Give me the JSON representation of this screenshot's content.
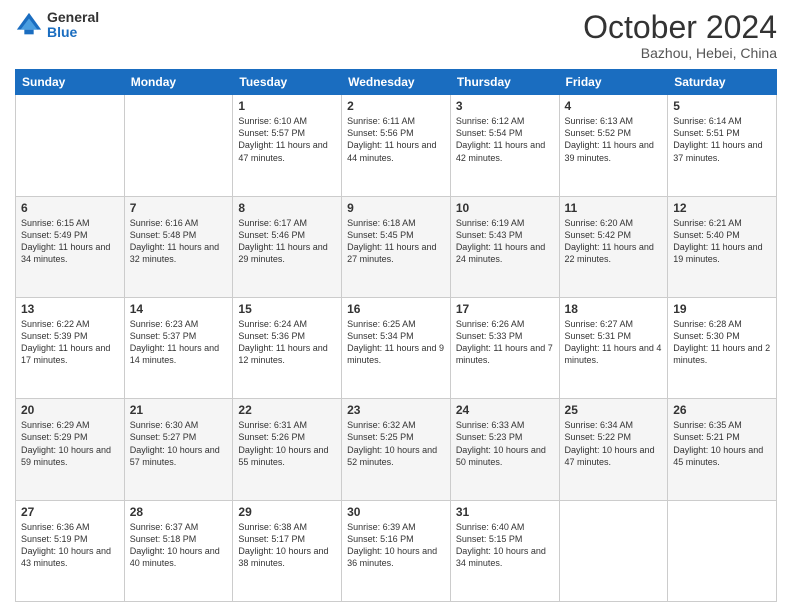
{
  "header": {
    "logo_general": "General",
    "logo_blue": "Blue",
    "month_title": "October 2024",
    "location": "Bazhou, Hebei, China"
  },
  "days_of_week": [
    "Sunday",
    "Monday",
    "Tuesday",
    "Wednesday",
    "Thursday",
    "Friday",
    "Saturday"
  ],
  "weeks": [
    [
      {
        "day": "",
        "sunrise": "",
        "sunset": "",
        "daylight": ""
      },
      {
        "day": "",
        "sunrise": "",
        "sunset": "",
        "daylight": ""
      },
      {
        "day": "1",
        "sunrise": "Sunrise: 6:10 AM",
        "sunset": "Sunset: 5:57 PM",
        "daylight": "Daylight: 11 hours and 47 minutes."
      },
      {
        "day": "2",
        "sunrise": "Sunrise: 6:11 AM",
        "sunset": "Sunset: 5:56 PM",
        "daylight": "Daylight: 11 hours and 44 minutes."
      },
      {
        "day": "3",
        "sunrise": "Sunrise: 6:12 AM",
        "sunset": "Sunset: 5:54 PM",
        "daylight": "Daylight: 11 hours and 42 minutes."
      },
      {
        "day": "4",
        "sunrise": "Sunrise: 6:13 AM",
        "sunset": "Sunset: 5:52 PM",
        "daylight": "Daylight: 11 hours and 39 minutes."
      },
      {
        "day": "5",
        "sunrise": "Sunrise: 6:14 AM",
        "sunset": "Sunset: 5:51 PM",
        "daylight": "Daylight: 11 hours and 37 minutes."
      }
    ],
    [
      {
        "day": "6",
        "sunrise": "Sunrise: 6:15 AM",
        "sunset": "Sunset: 5:49 PM",
        "daylight": "Daylight: 11 hours and 34 minutes."
      },
      {
        "day": "7",
        "sunrise": "Sunrise: 6:16 AM",
        "sunset": "Sunset: 5:48 PM",
        "daylight": "Daylight: 11 hours and 32 minutes."
      },
      {
        "day": "8",
        "sunrise": "Sunrise: 6:17 AM",
        "sunset": "Sunset: 5:46 PM",
        "daylight": "Daylight: 11 hours and 29 minutes."
      },
      {
        "day": "9",
        "sunrise": "Sunrise: 6:18 AM",
        "sunset": "Sunset: 5:45 PM",
        "daylight": "Daylight: 11 hours and 27 minutes."
      },
      {
        "day": "10",
        "sunrise": "Sunrise: 6:19 AM",
        "sunset": "Sunset: 5:43 PM",
        "daylight": "Daylight: 11 hours and 24 minutes."
      },
      {
        "day": "11",
        "sunrise": "Sunrise: 6:20 AM",
        "sunset": "Sunset: 5:42 PM",
        "daylight": "Daylight: 11 hours and 22 minutes."
      },
      {
        "day": "12",
        "sunrise": "Sunrise: 6:21 AM",
        "sunset": "Sunset: 5:40 PM",
        "daylight": "Daylight: 11 hours and 19 minutes."
      }
    ],
    [
      {
        "day": "13",
        "sunrise": "Sunrise: 6:22 AM",
        "sunset": "Sunset: 5:39 PM",
        "daylight": "Daylight: 11 hours and 17 minutes."
      },
      {
        "day": "14",
        "sunrise": "Sunrise: 6:23 AM",
        "sunset": "Sunset: 5:37 PM",
        "daylight": "Daylight: 11 hours and 14 minutes."
      },
      {
        "day": "15",
        "sunrise": "Sunrise: 6:24 AM",
        "sunset": "Sunset: 5:36 PM",
        "daylight": "Daylight: 11 hours and 12 minutes."
      },
      {
        "day": "16",
        "sunrise": "Sunrise: 6:25 AM",
        "sunset": "Sunset: 5:34 PM",
        "daylight": "Daylight: 11 hours and 9 minutes."
      },
      {
        "day": "17",
        "sunrise": "Sunrise: 6:26 AM",
        "sunset": "Sunset: 5:33 PM",
        "daylight": "Daylight: 11 hours and 7 minutes."
      },
      {
        "day": "18",
        "sunrise": "Sunrise: 6:27 AM",
        "sunset": "Sunset: 5:31 PM",
        "daylight": "Daylight: 11 hours and 4 minutes."
      },
      {
        "day": "19",
        "sunrise": "Sunrise: 6:28 AM",
        "sunset": "Sunset: 5:30 PM",
        "daylight": "Daylight: 11 hours and 2 minutes."
      }
    ],
    [
      {
        "day": "20",
        "sunrise": "Sunrise: 6:29 AM",
        "sunset": "Sunset: 5:29 PM",
        "daylight": "Daylight: 10 hours and 59 minutes."
      },
      {
        "day": "21",
        "sunrise": "Sunrise: 6:30 AM",
        "sunset": "Sunset: 5:27 PM",
        "daylight": "Daylight: 10 hours and 57 minutes."
      },
      {
        "day": "22",
        "sunrise": "Sunrise: 6:31 AM",
        "sunset": "Sunset: 5:26 PM",
        "daylight": "Daylight: 10 hours and 55 minutes."
      },
      {
        "day": "23",
        "sunrise": "Sunrise: 6:32 AM",
        "sunset": "Sunset: 5:25 PM",
        "daylight": "Daylight: 10 hours and 52 minutes."
      },
      {
        "day": "24",
        "sunrise": "Sunrise: 6:33 AM",
        "sunset": "Sunset: 5:23 PM",
        "daylight": "Daylight: 10 hours and 50 minutes."
      },
      {
        "day": "25",
        "sunrise": "Sunrise: 6:34 AM",
        "sunset": "Sunset: 5:22 PM",
        "daylight": "Daylight: 10 hours and 47 minutes."
      },
      {
        "day": "26",
        "sunrise": "Sunrise: 6:35 AM",
        "sunset": "Sunset: 5:21 PM",
        "daylight": "Daylight: 10 hours and 45 minutes."
      }
    ],
    [
      {
        "day": "27",
        "sunrise": "Sunrise: 6:36 AM",
        "sunset": "Sunset: 5:19 PM",
        "daylight": "Daylight: 10 hours and 43 minutes."
      },
      {
        "day": "28",
        "sunrise": "Sunrise: 6:37 AM",
        "sunset": "Sunset: 5:18 PM",
        "daylight": "Daylight: 10 hours and 40 minutes."
      },
      {
        "day": "29",
        "sunrise": "Sunrise: 6:38 AM",
        "sunset": "Sunset: 5:17 PM",
        "daylight": "Daylight: 10 hours and 38 minutes."
      },
      {
        "day": "30",
        "sunrise": "Sunrise: 6:39 AM",
        "sunset": "Sunset: 5:16 PM",
        "daylight": "Daylight: 10 hours and 36 minutes."
      },
      {
        "day": "31",
        "sunrise": "Sunrise: 6:40 AM",
        "sunset": "Sunset: 5:15 PM",
        "daylight": "Daylight: 10 hours and 34 minutes."
      },
      {
        "day": "",
        "sunrise": "",
        "sunset": "",
        "daylight": ""
      },
      {
        "day": "",
        "sunrise": "",
        "sunset": "",
        "daylight": ""
      }
    ]
  ]
}
